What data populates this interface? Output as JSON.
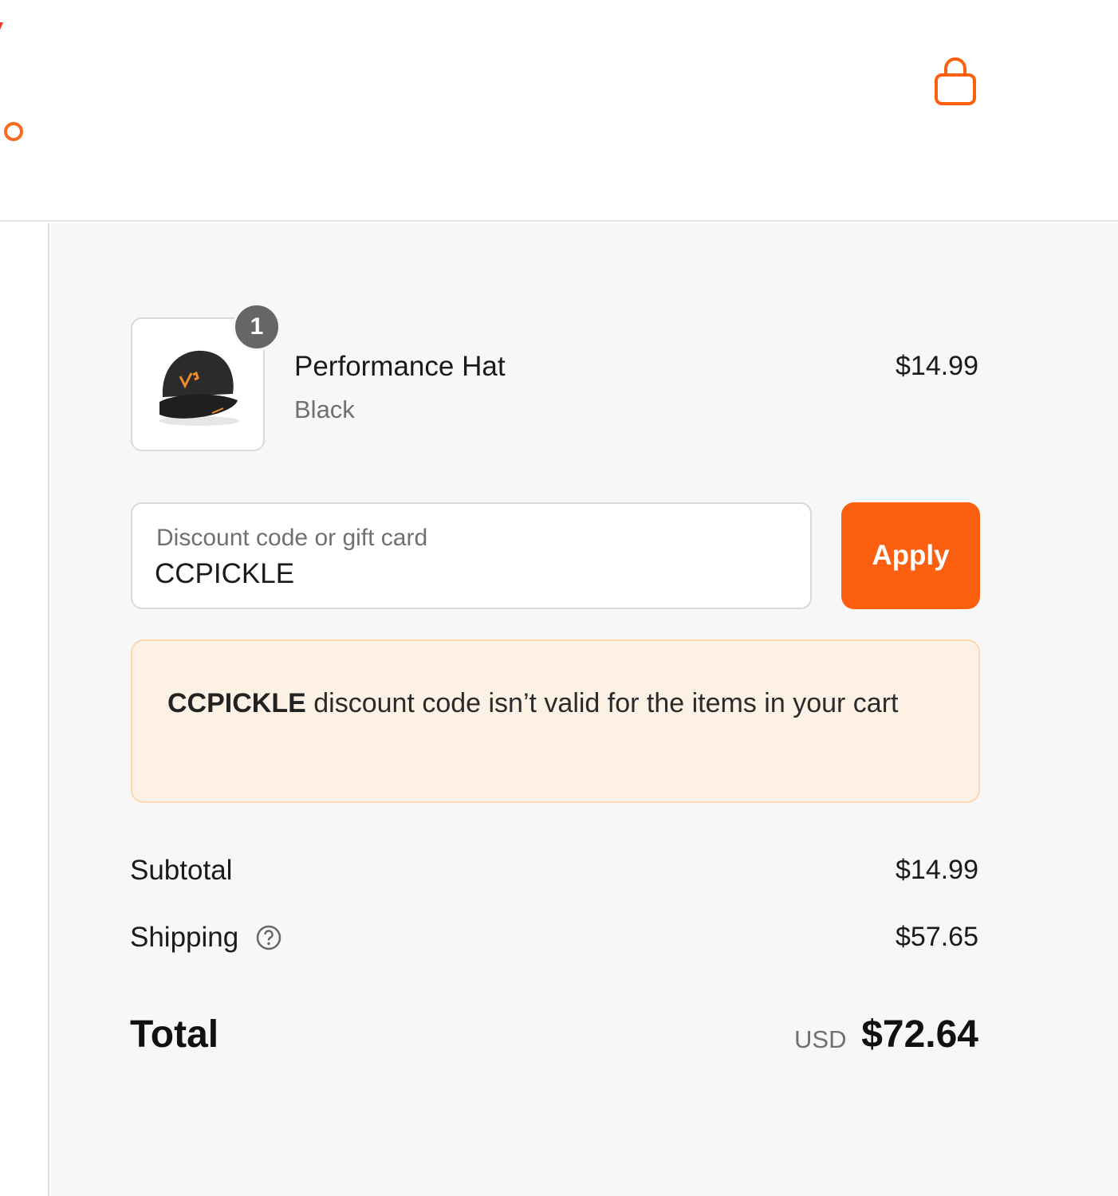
{
  "brand": {
    "accent": "#fb5f0f",
    "banner_bg": "#fdf1e5",
    "banner_border": "#fbd8b3"
  },
  "header": {
    "cart_icon": "shopping-bag-icon"
  },
  "cart": {
    "items": [
      {
        "quantity": "1",
        "name": "Performance Hat",
        "variant": "Black",
        "price": "$14.99",
        "image": "black-cap-product-image"
      }
    ]
  },
  "discount": {
    "label": "Discount code or gift card",
    "value": "CCPICKLE",
    "apply_label": "Apply",
    "error_code": "CCPICKLE",
    "error_message": " discount code isn’t valid for the items in your cart"
  },
  "summary": {
    "subtotal_label": "Subtotal",
    "subtotal_value": "$14.99",
    "shipping_label": "Shipping",
    "shipping_help_icon": "question-circle-icon",
    "shipping_value": "$57.65",
    "total_label": "Total",
    "total_currency": "USD",
    "total_value": "$72.64"
  }
}
